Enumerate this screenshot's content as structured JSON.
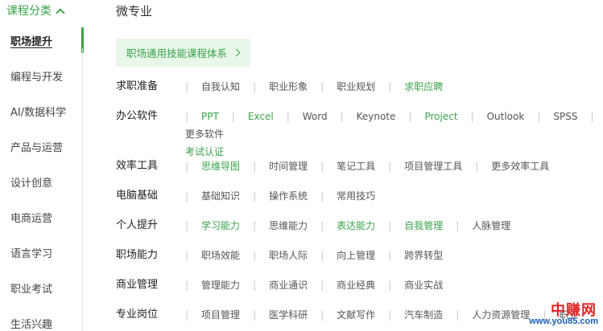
{
  "sidebar": {
    "header": "课程分类",
    "items": [
      {
        "label": "职场提升",
        "active": true
      },
      {
        "label": "编程与开发",
        "active": false
      },
      {
        "label": "AI/数据科学",
        "active": false
      },
      {
        "label": "产品与运营",
        "active": false
      },
      {
        "label": "设计创意",
        "active": false
      },
      {
        "label": "电商运营",
        "active": false
      },
      {
        "label": "语言学习",
        "active": false
      },
      {
        "label": "职业考试",
        "active": false
      },
      {
        "label": "生活兴趣",
        "active": false
      }
    ]
  },
  "main": {
    "title": "微专业",
    "path_box": "职场通用技能课程体系",
    "categories": [
      {
        "label": "求职准备",
        "tags": [
          {
            "text": "自我认知",
            "hl": false
          },
          {
            "text": "职业形象",
            "hl": false
          },
          {
            "text": "职业规划",
            "hl": false
          },
          {
            "text": "求职应聘",
            "hl": true
          }
        ]
      },
      {
        "label": "办公软件",
        "tags": [
          {
            "text": "PPT",
            "hl": true
          },
          {
            "text": "Excel",
            "hl": true
          },
          {
            "text": "Word",
            "hl": false
          },
          {
            "text": "Keynote",
            "hl": false
          },
          {
            "text": "Project",
            "hl": true
          },
          {
            "text": "Outlook",
            "hl": false
          },
          {
            "text": "SPSS",
            "hl": false
          },
          {
            "text": "更多软件",
            "hl": false
          },
          {
            "text": "考试认证",
            "hl": true
          }
        ]
      },
      {
        "label": "效率工具",
        "tags": [
          {
            "text": "思维导图",
            "hl": true
          },
          {
            "text": "时间管理",
            "hl": false
          },
          {
            "text": "笔记工具",
            "hl": false
          },
          {
            "text": "项目管理工具",
            "hl": false
          },
          {
            "text": "更多效率工具",
            "hl": false
          }
        ]
      },
      {
        "label": "电脑基础",
        "tags": [
          {
            "text": "基础知识",
            "hl": false
          },
          {
            "text": "操作系统",
            "hl": false
          },
          {
            "text": "常用技巧",
            "hl": false
          }
        ]
      },
      {
        "label": "个人提升",
        "tags": [
          {
            "text": "学习能力",
            "hl": true
          },
          {
            "text": "思维能力",
            "hl": false
          },
          {
            "text": "表达能力",
            "hl": true
          },
          {
            "text": "自我管理",
            "hl": true
          },
          {
            "text": "人脉管理",
            "hl": false
          }
        ]
      },
      {
        "label": "职场能力",
        "tags": [
          {
            "text": "职场效能",
            "hl": false
          },
          {
            "text": "职场人际",
            "hl": false
          },
          {
            "text": "向上管理",
            "hl": false
          },
          {
            "text": "跨界转型",
            "hl": false
          }
        ]
      },
      {
        "label": "商业管理",
        "tags": [
          {
            "text": "管理能力",
            "hl": false
          },
          {
            "text": "商业通识",
            "hl": false
          },
          {
            "text": "商业经典",
            "hl": false
          },
          {
            "text": "商业实战",
            "hl": false
          }
        ]
      },
      {
        "label": "专业岗位",
        "tags": [
          {
            "text": "项目管理",
            "hl": false
          },
          {
            "text": "医学科研",
            "hl": false
          },
          {
            "text": "文献写作",
            "hl": false
          },
          {
            "text": "汽车制造",
            "hl": false
          },
          {
            "text": "人力资源管理",
            "hl": false
          },
          {
            "text": "职业",
            "hl": false
          }
        ]
      }
    ]
  },
  "watermark": {
    "top": "中赚网",
    "bottom": "www.you85.com"
  },
  "colors": {
    "accent": "#39a34a",
    "accent_bg": "#e9f7ea",
    "separator": "#c8c8c8"
  }
}
